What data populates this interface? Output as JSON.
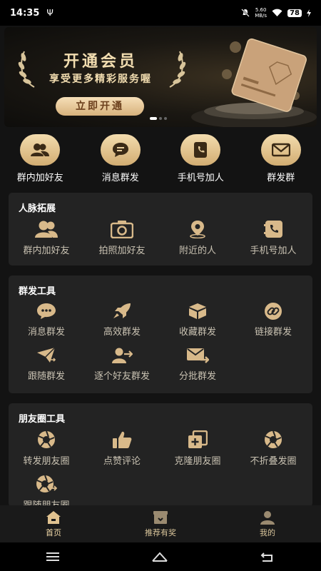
{
  "status_bar": {
    "time": "14:35",
    "usb_symbol": "Ψ",
    "net_speed": "5.60",
    "net_unit": "MB/s",
    "battery": "78"
  },
  "banner": {
    "title": "开通会员",
    "subtitle": "享受更多精彩服务喔",
    "cta": "立即开通"
  },
  "quick_actions": [
    {
      "label": "群内加好友",
      "icon": "users-icon"
    },
    {
      "label": "消息群发",
      "icon": "chat-bubble-icon"
    },
    {
      "label": "手机号加人",
      "icon": "phone-book-icon"
    },
    {
      "label": "群发群",
      "icon": "mail-icon"
    }
  ],
  "network_section": {
    "title": "人脉拓展",
    "items": [
      {
        "label": "群内加好友",
        "icon": "users-icon"
      },
      {
        "label": "拍照加好友",
        "icon": "camera-icon"
      },
      {
        "label": "附近的人",
        "icon": "location-pin-icon"
      },
      {
        "label": "手机号加人",
        "icon": "phone-book-icon"
      }
    ]
  },
  "broadcast_section": {
    "title": "群发工具",
    "items": [
      {
        "label": "消息群发",
        "icon": "chat-bubble-icon"
      },
      {
        "label": "高效群发",
        "icon": "rocket-icon"
      },
      {
        "label": "收藏群发",
        "icon": "box-icon"
      },
      {
        "label": "链接群发",
        "icon": "link-icon"
      },
      {
        "label": "跟随群发",
        "icon": "paper-plane-icon"
      },
      {
        "label": "逐个好友群发",
        "icon": "user-send-icon"
      },
      {
        "label": "分批群发",
        "icon": "mail-forward-icon"
      }
    ]
  },
  "moments_section": {
    "title": "朋友圈工具",
    "items": [
      {
        "label": "转发朋友圈",
        "icon": "aperture-icon"
      },
      {
        "label": "点赞评论",
        "icon": "thumbs-up-icon"
      },
      {
        "label": "克隆朋友圈",
        "icon": "clone-icon"
      },
      {
        "label": "不折叠发圈",
        "icon": "aperture-icon"
      },
      {
        "label": "跟随朋友圈",
        "icon": "aperture-shuffle-icon"
      }
    ]
  },
  "bottom_nav": [
    {
      "label": "首页",
      "icon": "home-icon",
      "active": true
    },
    {
      "label": "推荐有奖",
      "icon": "gift-box-icon",
      "active": false
    },
    {
      "label": "我的",
      "icon": "person-icon",
      "active": false
    }
  ],
  "colors": {
    "accent": "#d8b98a",
    "background": "#131313",
    "card": "#232323"
  }
}
